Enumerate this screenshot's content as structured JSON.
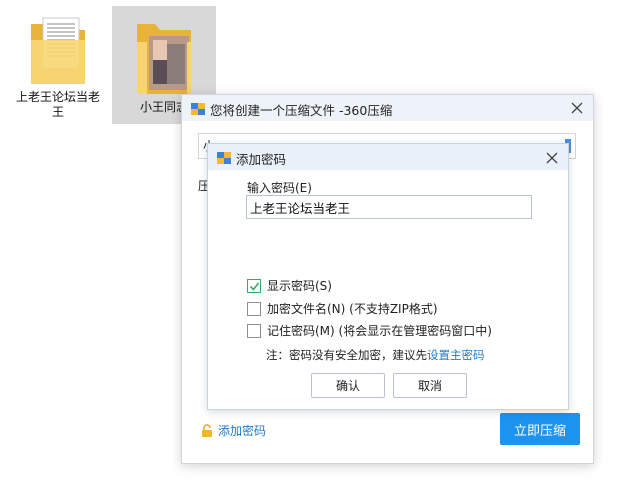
{
  "desktop": {
    "icons": [
      {
        "label": "上老王论坛当老王",
        "icon": "folder-icon",
        "selected": false
      },
      {
        "label": "小王同志",
        "icon": "folder-icon",
        "selected": true
      }
    ]
  },
  "main_dialog": {
    "title": "您将创建一个压缩文件 -360压缩",
    "path_value": "小",
    "compress_label": "压",
    "add_password_link": "添加密码",
    "compress_button": "立即压缩"
  },
  "password_dialog": {
    "title": "添加密码",
    "input_label": "输入密码(E)",
    "password_value": "上老王论坛当老王",
    "options": [
      {
        "label": "显示密码(S)",
        "checked": true
      },
      {
        "label": "加密文件名(N) (不支持ZIP格式)",
        "checked": false
      },
      {
        "label": "记住密码(M) (将会显示在管理密码窗口中)",
        "checked": false
      }
    ],
    "note_prefix": "注：密码没有安全加密，建议先",
    "note_link": "设置主密码",
    "ok_button": "确认",
    "cancel_button": "取消"
  },
  "colors": {
    "accent": "#1d93f0",
    "link": "#1f7bc7",
    "check": "#3aa86b",
    "titlebar": "#eef3f9"
  }
}
